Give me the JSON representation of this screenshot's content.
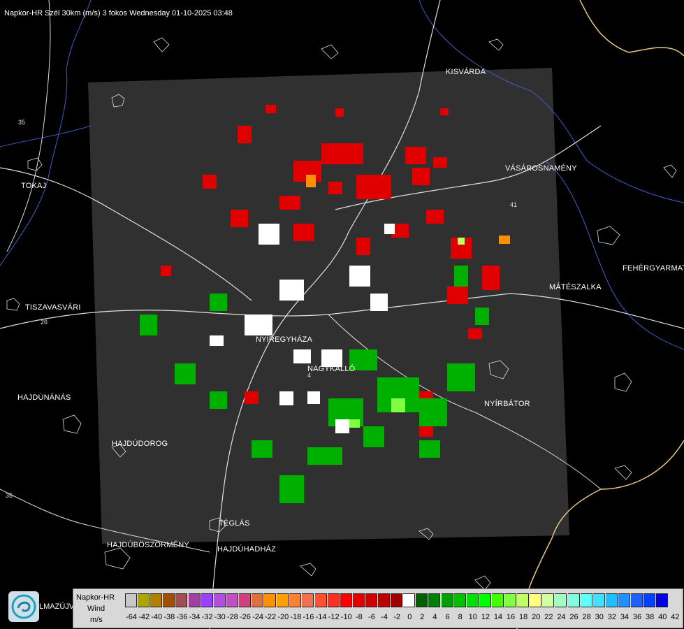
{
  "title": "Napkor-HR Szél 30km (m/s) 3 fokos Wednesday 01-10-2025 03:48",
  "towns": [
    {
      "name": "KISVÁRDA",
      "id": "kisvarda"
    },
    {
      "name": "VÁSÁROSNAMÉNY",
      "id": "vasarosnameny"
    },
    {
      "name": "TOKAJ",
      "id": "tokaj"
    },
    {
      "name": "FEHÉRGYARMAT",
      "id": "fehergyarmat"
    },
    {
      "name": "MÁTÉSZALKA",
      "id": "mateszalka"
    },
    {
      "name": "TISZAVASVÁRI",
      "id": "tiszavasvari"
    },
    {
      "name": "NYÍREGYHÁZA",
      "id": "nyiregyhaza"
    },
    {
      "name": "NAGYKÁLLÓ",
      "id": "nagykallo"
    },
    {
      "name": "HAJDÚNÁNÁS",
      "id": "hajdunanas"
    },
    {
      "name": "NYÍRBÁTOR",
      "id": "nyirbator"
    },
    {
      "name": "HAJDÚDOROG",
      "id": "hajdudorog"
    },
    {
      "name": "TÉGLÁS",
      "id": "teglas"
    },
    {
      "name": "HAJDÚBÖSZÖRMÉNY",
      "id": "hajduboszormeny"
    },
    {
      "name": "HAJDÚHADHÁZ",
      "id": "hajduhadhaz"
    }
  ],
  "road_numbers": [
    "35",
    "26",
    "4",
    "41",
    "35"
  ],
  "logo_text": "LMAZÚJVÁR",
  "legend": {
    "line1": "Napkor-HR",
    "line2": "Wind",
    "line3": "m/s",
    "tick_labels": [
      "-64",
      "-42",
      "-40",
      "-38",
      "-36",
      "-34",
      "-32",
      "-30",
      "-28",
      "-26",
      "-24",
      "-22",
      "-20",
      "-18",
      "-16",
      "-14",
      "-12",
      "-10",
      "-8",
      "-6",
      "-4",
      "-2",
      "0",
      "2",
      "4",
      "6",
      "8",
      "10",
      "12",
      "14",
      "16",
      "18",
      "20",
      "22",
      "24",
      "26",
      "28",
      "30",
      "32",
      "34",
      "36",
      "38",
      "40",
      "42"
    ],
    "colors": [
      "#c8c8c8",
      "#a8a800",
      "#b08000",
      "#a05000",
      "#a05050",
      "#a040a0",
      "#9a40ff",
      "#b050e0",
      "#c050c0",
      "#d04080",
      "#e07040",
      "#ff9000",
      "#ffa000",
      "#ff8030",
      "#f07050",
      "#ff5030",
      "#ff3020",
      "#ff0000",
      "#e00000",
      "#d00000",
      "#c00000",
      "#a00000",
      "#ffffff",
      "#006000",
      "#008000",
      "#00a000",
      "#00c000",
      "#00e000",
      "#00ff00",
      "#40ff00",
      "#80ff40",
      "#c0ff60",
      "#ffff80",
      "#d0ffa0",
      "#a0ffc0",
      "#80ffe0",
      "#60ffff",
      "#40e0ff",
      "#20c0ff",
      "#2090ff",
      "#2060ff",
      "#0040ff",
      "#0000e0"
    ]
  }
}
